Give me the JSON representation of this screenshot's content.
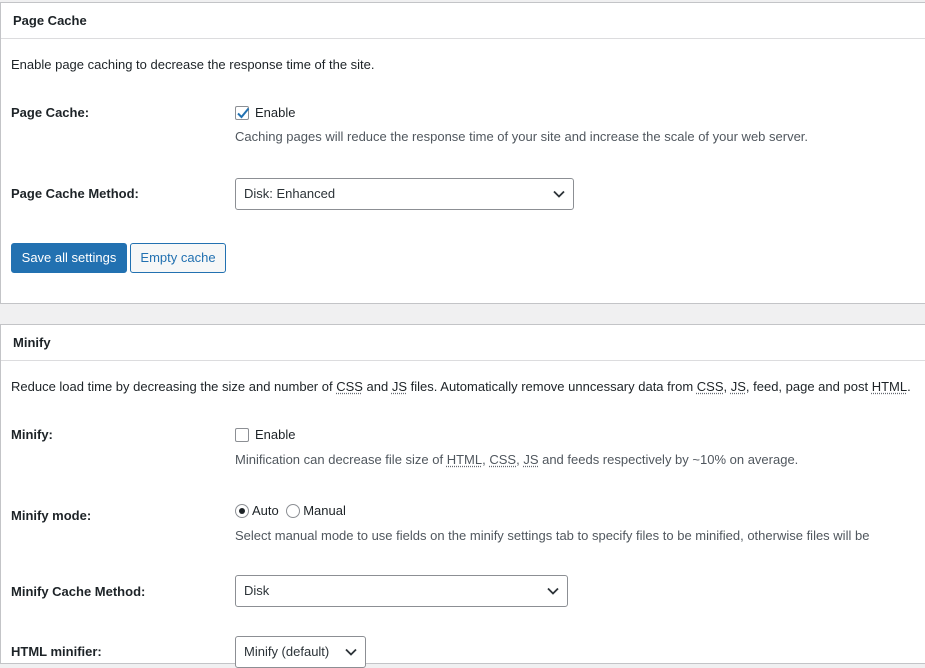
{
  "page_cache": {
    "title": "Page Cache",
    "intro": "Enable page caching to decrease the response time of the site.",
    "enable_label": "Page Cache:",
    "enable_checkbox_text": "Enable",
    "enable_checked": true,
    "enable_desc": "Caching pages will reduce the response time of your site and increase the scale of your web server.",
    "method_label": "Page Cache Method:",
    "method_value": "Disk: Enhanced",
    "save_button": "Save all settings",
    "empty_button": "Empty cache"
  },
  "minify": {
    "title": "Minify",
    "intro": {
      "p1": "Reduce load time by decreasing the size and number of ",
      "css1": "CSS",
      "p2": " and ",
      "js1": "JS",
      "p3": " files. Automatically remove unncessary data from ",
      "css2": "CSS",
      "p4": ", ",
      "js2": "JS",
      "p5": ", feed, page and post ",
      "html1": "HTML",
      "p6": "."
    },
    "enable_label": "Minify:",
    "enable_checkbox_text": "Enable",
    "enable_checked": false,
    "enable_desc": {
      "p1": "Minification can decrease file size of ",
      "html": "HTML",
      "p2": ", ",
      "css": "CSS",
      "p3": ", ",
      "js": "JS",
      "p4": " and feeds respectively by ~10% on average."
    },
    "mode_label": "Minify mode:",
    "mode_options": [
      "Auto",
      "Manual"
    ],
    "mode_selected": "Auto",
    "mode_desc": "Select manual mode to use fields on the minify settings tab to specify files to be minified, otherwise files will be",
    "cache_method_label": "Minify Cache Method:",
    "cache_method_value": "Disk",
    "html_minifier_label": "HTML minifier:",
    "html_minifier_value": "Minify (default)"
  },
  "colors": {
    "primary": "#2271b1",
    "background": "#f0f0f1",
    "panel": "#ffffff"
  },
  "icons": [
    "checkmark-icon",
    "chevron-down-icon"
  ]
}
